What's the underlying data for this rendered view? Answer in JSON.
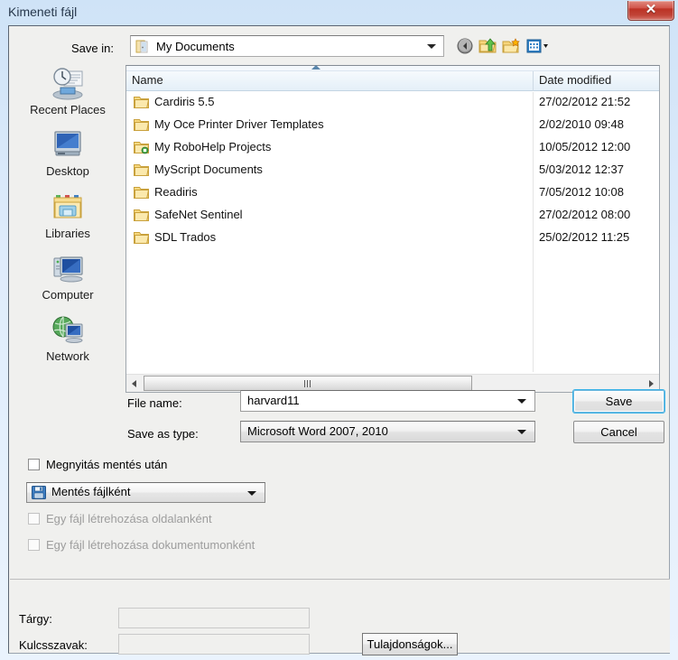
{
  "window": {
    "title": "Kimeneti fájl",
    "close_label": "✕"
  },
  "toolbar": {
    "save_in_label": "Save in:",
    "save_in_value": "My Documents",
    "buttons": [
      {
        "name": "back-button",
        "icon": "back-arrow-icon"
      },
      {
        "name": "up-one-level-button",
        "icon": "folder-up-icon"
      },
      {
        "name": "create-new-folder-button",
        "icon": "new-folder-icon"
      },
      {
        "name": "views-button",
        "icon": "views-grid-icon"
      }
    ]
  },
  "places": [
    {
      "label": "Recent Places",
      "icon": "recent-places-icon"
    },
    {
      "label": "Desktop",
      "icon": "desktop-icon"
    },
    {
      "label": "Libraries",
      "icon": "libraries-icon"
    },
    {
      "label": "Computer",
      "icon": "computer-icon"
    },
    {
      "label": "Network",
      "icon": "network-icon"
    }
  ],
  "filelist": {
    "columns": [
      "Name",
      "Date modified"
    ],
    "sort": "ascending",
    "rows": [
      {
        "name": "Cardiris 5.5",
        "date": "27/02/2012 21:52",
        "icon": "folder-icon"
      },
      {
        "name": "My Oce Printer Driver Templates",
        "date": "2/02/2010 09:48",
        "icon": "folder-icon"
      },
      {
        "name": "My RoboHelp Projects",
        "date": "10/05/2012 12:00",
        "icon": "folder-special-icon"
      },
      {
        "name": "MyScript Documents",
        "date": "5/03/2012 12:37",
        "icon": "folder-icon"
      },
      {
        "name": "Readiris",
        "date": "7/05/2012 10:08",
        "icon": "folder-icon"
      },
      {
        "name": "SafeNet Sentinel",
        "date": "27/02/2012 08:00",
        "icon": "folder-icon"
      },
      {
        "name": "SDL Trados",
        "date": "25/02/2012 11:25",
        "icon": "folder-icon"
      }
    ]
  },
  "form": {
    "filename_label": "File name:",
    "filename_value": "harvard11",
    "savetype_label": "Save as type:",
    "savetype_value": "Microsoft Word 2007, 2010",
    "save_button": "Save",
    "cancel_button": "Cancel"
  },
  "options": {
    "open_after_save": {
      "label": "Megnyitás mentés után",
      "checked": false,
      "disabled": false
    },
    "save_mode_value": "Mentés fájlként",
    "save_mode_icon": "floppy-save-icon",
    "one_file_per_page": {
      "label": "Egy fájl létrehozása oldalanként",
      "checked": false,
      "disabled": true
    },
    "one_file_per_document": {
      "label": "Egy fájl létrehozása dokumentumonként",
      "checked": false,
      "disabled": true
    }
  },
  "metadata": {
    "subject_label": "Tárgy:",
    "subject_value": "",
    "keywords_label": "Kulcsszavak:",
    "keywords_value": "",
    "properties_button": "Tulajdonságok..."
  },
  "colors": {
    "titlebar_blue": "#cfe3f7",
    "close_red": "#bb3225",
    "focus_ring": "#3cb3e8",
    "folder_yellow": "#fcd77a",
    "client_bg": "#f0f0ee"
  }
}
